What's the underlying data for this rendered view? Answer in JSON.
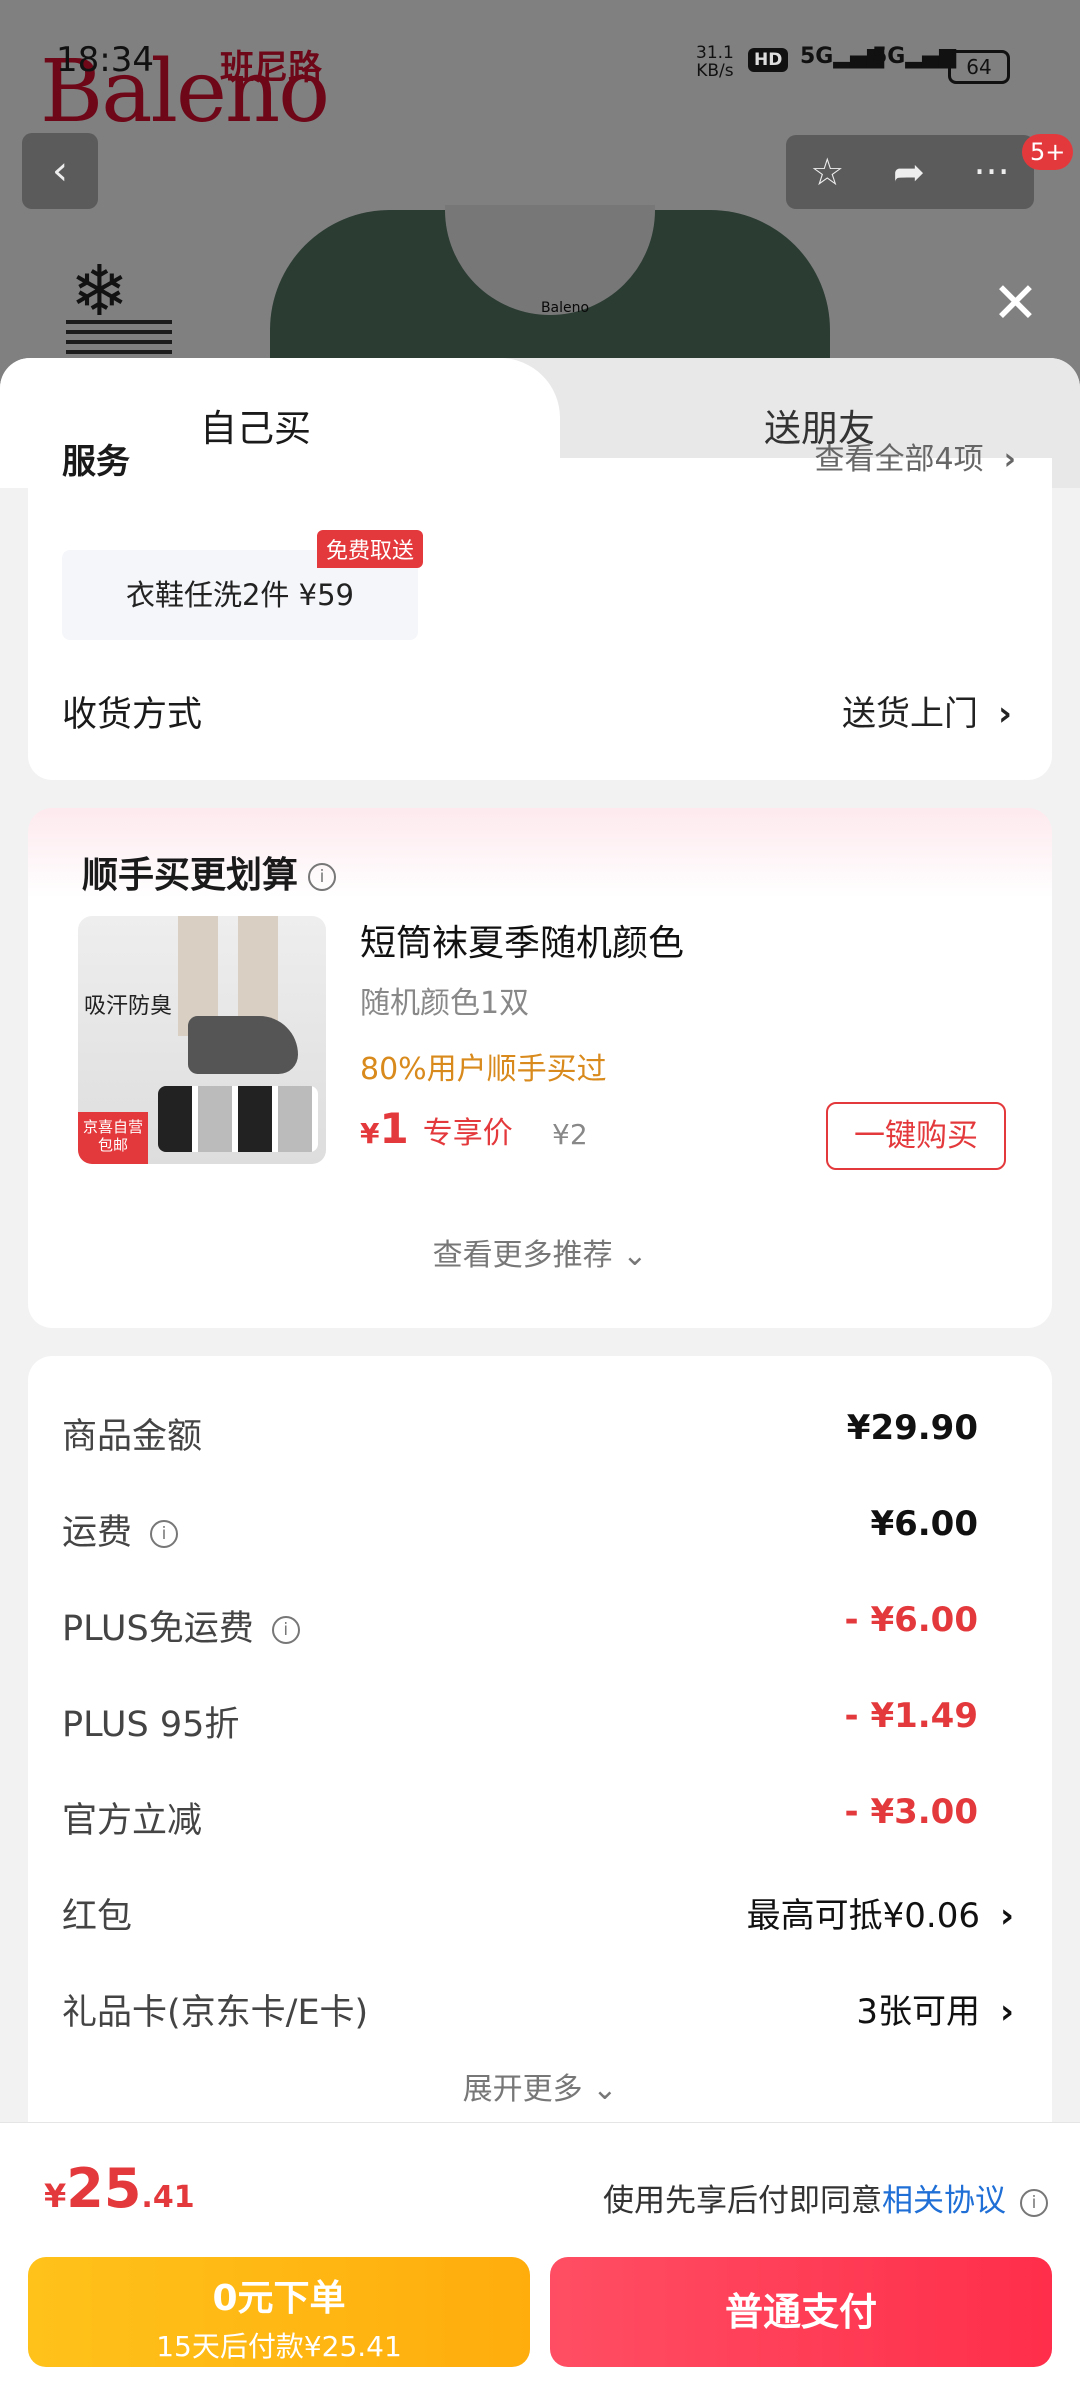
{
  "status_bar": {
    "time": "18:34",
    "net_speed_value": "31.1",
    "net_speed_unit": "KB/s",
    "hd": "HD",
    "sig1": "5G",
    "sig2": "5G",
    "battery": "64"
  },
  "background": {
    "brand": "Baleno",
    "brand_cn": "班尼路",
    "shirt_tag": "Baleno",
    "notification_badge": "5+"
  },
  "tabs": {
    "self": "自己买",
    "friend": "送朋友"
  },
  "services": {
    "title": "服务",
    "more": "查看全部4项",
    "item_label": "衣鞋任洗2件  ¥59",
    "item_tag": "免费取送"
  },
  "delivery": {
    "label": "收货方式",
    "value": "送货上门"
  },
  "addon": {
    "title": "顺手买更划算",
    "product_image_text": "吸汗防臭",
    "product_image_corner": "京喜自营 包邮",
    "product_name": "短筒袜夏季随机颜色",
    "product_spec": "随机颜色1双",
    "social_proof": "80%用户顺手买过",
    "price_currency": "¥",
    "price_value": "1",
    "price_label": "专享价",
    "original_price": "¥2",
    "buy_button": "一键购买",
    "see_more": "查看更多推荐"
  },
  "fees": {
    "goods_label": "商品金额",
    "goods_value": "¥29.90",
    "shipping_label": "运费",
    "shipping_value": "¥6.00",
    "plus_free_label": "PLUS免运费",
    "plus_free_value": "- ¥6.00",
    "plus_discount_label": "PLUS 95折",
    "plus_discount_value": "- ¥1.49",
    "official_label": "官方立减",
    "official_value": "- ¥3.00",
    "redpacket_label": "红包",
    "redpacket_value": "最高可抵¥0.06",
    "giftcard_label": "礼品卡(京东卡/E卡)",
    "giftcard_value": "3张可用",
    "expand": "展开更多"
  },
  "bottom": {
    "total_currency": "¥",
    "total_int": "25",
    "total_dec": ".41",
    "agree_text": "使用先享后付即同意",
    "agree_link": "相关协议",
    "bnpl_line1": "0元下单",
    "bnpl_line2": "15天后付款¥25.41",
    "pay_label": "普通支付"
  },
  "colors": {
    "accent_red": "#e4393c",
    "bnpl_yellow": "#ffb514",
    "link_blue": "#1f6fd6",
    "social_orange": "#d98a1c"
  }
}
